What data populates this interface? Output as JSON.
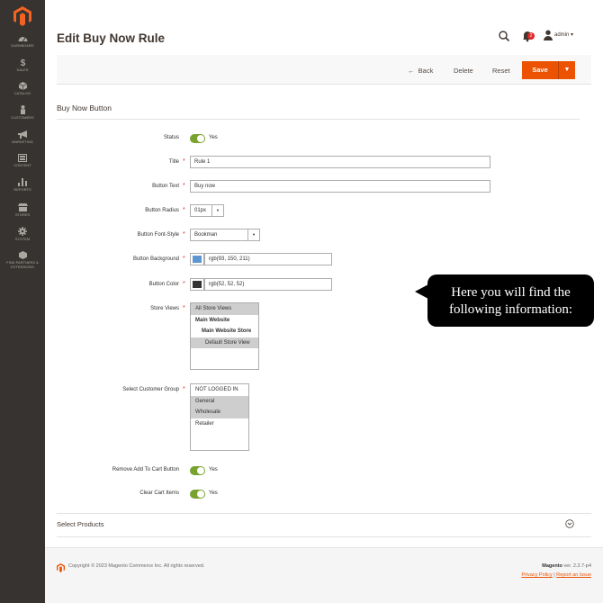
{
  "sidebar": {
    "items": [
      {
        "label": "DASHBOARD",
        "icon": "dashboard-icon"
      },
      {
        "label": "SALES",
        "icon": "dollar-icon"
      },
      {
        "label": "CATALOG",
        "icon": "cube-icon"
      },
      {
        "label": "CUSTOMERS",
        "icon": "person-icon"
      },
      {
        "label": "MARKETING",
        "icon": "megaphone-icon"
      },
      {
        "label": "CONTENT",
        "icon": "content-icon"
      },
      {
        "label": "REPORTS",
        "icon": "bar-chart-icon"
      },
      {
        "label": "STORES",
        "icon": "store-icon"
      },
      {
        "label": "SYSTEM",
        "icon": "gear-icon"
      },
      {
        "label": "FIND PARTNERS & EXTENSIONS",
        "icon": "box-icon"
      }
    ]
  },
  "header": {
    "title": "Edit Buy Now Rule",
    "notification_count": "2",
    "user_name": "admin",
    "user_caret": "▾"
  },
  "actions": {
    "back": "Back",
    "back_arrow": "←",
    "delete": "Delete",
    "reset": "Reset",
    "save": "Save",
    "save_split": "▼"
  },
  "section": {
    "title": "Buy Now Button"
  },
  "form": {
    "status": {
      "label": "Status",
      "value": "Yes"
    },
    "title": {
      "label": "Title",
      "value": "Rule 1"
    },
    "button_text": {
      "label": "Button Text",
      "value": "Buy now"
    },
    "button_radius": {
      "label": "Button Radius",
      "value": "01px"
    },
    "button_font_style": {
      "label": "Button Font-Style",
      "value": "Bookman"
    },
    "button_background": {
      "label": "Button Background",
      "value": "rgb(93, 150, 211)",
      "swatch": "#5d96d3"
    },
    "button_color": {
      "label": "Button Color",
      "value": "rgb(52, 52, 52)",
      "swatch": "#343434"
    },
    "store_views": {
      "label": "Store Views",
      "options": [
        "All Store Views",
        "Main Website",
        "Main Website Store",
        "Default Store View"
      ]
    },
    "customer_group": {
      "label": "Select Customer Group",
      "options": [
        "NOT LOGGED IN",
        "General",
        "Wholesale",
        "Retailer"
      ]
    },
    "remove_add_to_cart": {
      "label": "Remove Add To Cart Button",
      "value": "Yes"
    },
    "clear_cart_items": {
      "label": "Clear Cart Items",
      "value": "Yes"
    },
    "required_mark": "*"
  },
  "select_products": {
    "title": "Select Products"
  },
  "footer": {
    "copyright": "Copyright © 2023 Magento Commerce Inc. All rights reserved.",
    "brand": "Magento",
    "version": "ver. 2.3.7-p4",
    "privacy": "Privacy Policy",
    "separator": "|",
    "report": "Report an Issue"
  },
  "callout": {
    "line1": "Here you will find the",
    "line2": "following information:"
  },
  "colors": {
    "accent": "#eb5202",
    "sidebar": "#373330",
    "toggle_on": "#79a22e"
  }
}
